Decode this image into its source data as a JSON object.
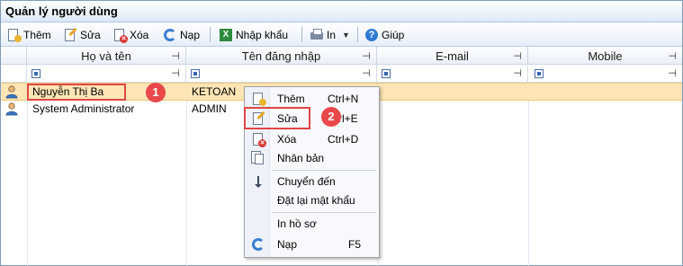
{
  "window": {
    "title": "Quản lý người dùng"
  },
  "toolbar": {
    "add_label": "Thêm",
    "edit_label": "Sửa",
    "delete_label": "Xóa",
    "reload_label": "Nạp",
    "import_label": "Nhập khẩu",
    "print_label": "In",
    "help_label": "Giúp"
  },
  "grid": {
    "columns": [
      "Họ và tên",
      "Tên đăng nhập",
      "E-mail",
      "Mobile"
    ],
    "rows": [
      {
        "full_name": "Nguyễn Thị Ba",
        "username": "KETOAN",
        "email": "",
        "mobile": ""
      },
      {
        "full_name": "System Administrator",
        "username": "ADMIN",
        "email": "",
        "mobile": ""
      }
    ],
    "pin_glyph": "⊣"
  },
  "annotations": {
    "badge1": "1",
    "badge2": "2"
  },
  "context_menu": {
    "items": [
      {
        "label": "Thêm",
        "shortcut": "Ctrl+N"
      },
      {
        "label": "Sửa",
        "shortcut": "Ctrl+E"
      },
      {
        "label": "Xóa",
        "shortcut": "Ctrl+D"
      },
      {
        "label": "Nhân bản",
        "shortcut": ""
      },
      {
        "label": "Chuyển đến",
        "shortcut": ""
      },
      {
        "label": "Đặt lại mật khẩu",
        "shortcut": ""
      },
      {
        "label": "In hồ sơ",
        "shortcut": ""
      },
      {
        "label": "Nạp",
        "shortcut": "F5"
      }
    ]
  },
  "colors": {
    "selected_row": "#fde5b5",
    "highlight_red": "#e04646",
    "accent_blue": "#3a7fd0"
  }
}
